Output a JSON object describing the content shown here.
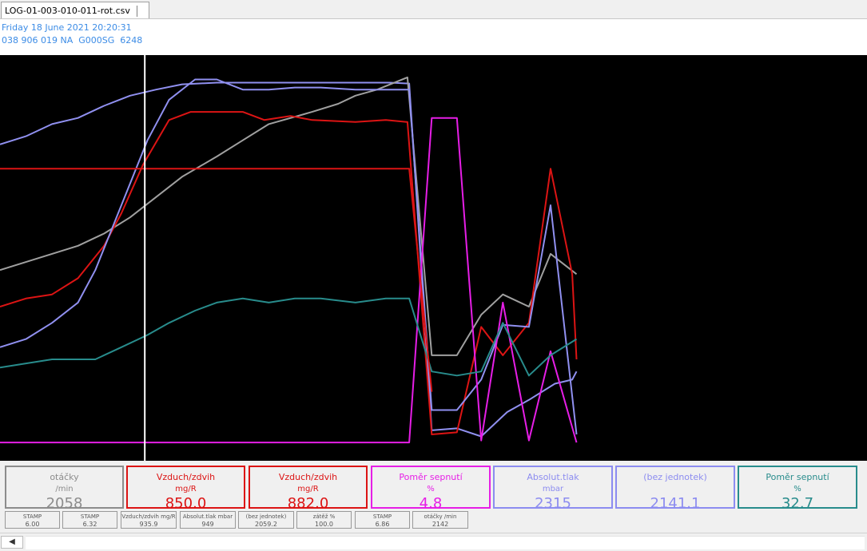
{
  "tab": {
    "filename": "LOG-01-003-010-011-rot.csv"
  },
  "info": {
    "date": "Friday 18 June 2021 20:20:31",
    "vehicle": "038 906 019 NA  G000SG  6248"
  },
  "gauges": [
    {
      "title": "otáčky",
      "unit": "/min",
      "value": "2058",
      "color": "#8c8c8c",
      "value_color": "#8c8c8c"
    },
    {
      "title": "Vzduch/zdvih",
      "unit": "mg/R",
      "value": "850.0",
      "color": "#dc1414",
      "value_color": "#dc1414"
    },
    {
      "title": "Vzduch/zdvih",
      "unit": "mg/R",
      "value": "882.0",
      "color": "#dc1414",
      "value_color": "#dc1414"
    },
    {
      "title": "Poměr sepnutí",
      "unit": "%",
      "value": "4.8",
      "color": "#e61ee6",
      "value_color": "#e61ee6"
    },
    {
      "title": "Absolut.tlak",
      "unit": "mbar",
      "value": "2315",
      "color": "#8c8cf0",
      "value_color": "#8c8cf0"
    },
    {
      "title": "(bez jednotek)",
      "unit": "",
      "value": "2141.1",
      "color": "#8c8cf0",
      "value_color": "#8c8cf0"
    },
    {
      "title": "Poměr sepnutí",
      "unit": "%",
      "value": "32.7",
      "color": "#288c8c",
      "value_color": "#288c8c"
    }
  ],
  "minis": [
    {
      "title": "STAMP",
      "value": "6.00"
    },
    {
      "title": "STAMP",
      "value": "6.32"
    },
    {
      "title": "Vzduch/zdvih mg/R",
      "value": "935.9"
    },
    {
      "title": "Absolut.tlak mbar",
      "value": "949"
    },
    {
      "title": "(bez jednotek)",
      "value": "2059.2"
    },
    {
      "title": "zátěž %",
      "value": "100.0"
    },
    {
      "title": "STAMP",
      "value": "6.86"
    },
    {
      "title": "otáčky /min",
      "value": "2142"
    }
  ],
  "chart_data": {
    "type": "line",
    "cursor_position": 0.167,
    "series": [
      {
        "color": "#9090f0",
        "points": [
          [
            0,
            0.22
          ],
          [
            0.03,
            0.2
          ],
          [
            0.06,
            0.17
          ],
          [
            0.09,
            0.155
          ],
          [
            0.12,
            0.125
          ],
          [
            0.15,
            0.1
          ],
          [
            0.18,
            0.085
          ],
          [
            0.21,
            0.072
          ],
          [
            0.25,
            0.068
          ],
          [
            0.29,
            0.068
          ],
          [
            0.33,
            0.068
          ],
          [
            0.37,
            0.068
          ],
          [
            0.41,
            0.068
          ],
          [
            0.45,
            0.068
          ],
          [
            0.472,
            0.07
          ],
          [
            0.498,
            0.925
          ],
          [
            0.527,
            0.92
          ],
          [
            0.555,
            0.94
          ],
          [
            0.585,
            0.88
          ],
          [
            0.61,
            0.85
          ],
          [
            0.64,
            0.81
          ],
          [
            0.66,
            0.8
          ],
          [
            0.665,
            0.78
          ]
        ]
      },
      {
        "color": "#a0a0a0",
        "points": [
          [
            0,
            0.53
          ],
          [
            0.03,
            0.51
          ],
          [
            0.06,
            0.49
          ],
          [
            0.09,
            0.47
          ],
          [
            0.12,
            0.44
          ],
          [
            0.15,
            0.4
          ],
          [
            0.18,
            0.35
          ],
          [
            0.21,
            0.3
          ],
          [
            0.25,
            0.25
          ],
          [
            0.28,
            0.21
          ],
          [
            0.31,
            0.17
          ],
          [
            0.36,
            0.14
          ],
          [
            0.39,
            0.12
          ],
          [
            0.41,
            0.1
          ],
          [
            0.435,
            0.085
          ],
          [
            0.47,
            0.055
          ],
          [
            0.498,
            0.74
          ],
          [
            0.527,
            0.74
          ],
          [
            0.555,
            0.64
          ],
          [
            0.58,
            0.59
          ],
          [
            0.61,
            0.62
          ],
          [
            0.635,
            0.49
          ],
          [
            0.665,
            0.54
          ]
        ]
      },
      {
        "color": "#dc1414",
        "points": [
          [
            0,
            0.62
          ],
          [
            0.03,
            0.6
          ],
          [
            0.06,
            0.59
          ],
          [
            0.09,
            0.55
          ],
          [
            0.12,
            0.47
          ],
          [
            0.14,
            0.39
          ],
          [
            0.165,
            0.27
          ],
          [
            0.195,
            0.16
          ],
          [
            0.22,
            0.14
          ],
          [
            0.25,
            0.14
          ],
          [
            0.28,
            0.14
          ],
          [
            0.305,
            0.16
          ],
          [
            0.335,
            0.15
          ],
          [
            0.36,
            0.16
          ],
          [
            0.41,
            0.165
          ],
          [
            0.445,
            0.16
          ],
          [
            0.47,
            0.165
          ],
          [
            0.498,
            0.935
          ],
          [
            0.527,
            0.93
          ],
          [
            0.555,
            0.67
          ],
          [
            0.58,
            0.74
          ],
          [
            0.61,
            0.66
          ],
          [
            0.635,
            0.28
          ],
          [
            0.66,
            0.54
          ],
          [
            0.665,
            0.75
          ]
        ]
      },
      {
        "color": "#9090f0",
        "points": [
          [
            0,
            0.72
          ],
          [
            0.03,
            0.7
          ],
          [
            0.06,
            0.66
          ],
          [
            0.09,
            0.61
          ],
          [
            0.11,
            0.53
          ],
          [
            0.14,
            0.37
          ],
          [
            0.17,
            0.21
          ],
          [
            0.195,
            0.11
          ],
          [
            0.225,
            0.06
          ],
          [
            0.25,
            0.06
          ],
          [
            0.28,
            0.085
          ],
          [
            0.31,
            0.085
          ],
          [
            0.34,
            0.08
          ],
          [
            0.37,
            0.08
          ],
          [
            0.41,
            0.085
          ],
          [
            0.445,
            0.085
          ],
          [
            0.472,
            0.085
          ],
          [
            0.498,
            0.875
          ],
          [
            0.527,
            0.875
          ],
          [
            0.555,
            0.8
          ],
          [
            0.58,
            0.665
          ],
          [
            0.61,
            0.67
          ],
          [
            0.635,
            0.37
          ],
          [
            0.665,
            0.935
          ]
        ]
      },
      {
        "color": "#e61ee6",
        "points": [
          [
            0,
            0.955
          ],
          [
            0.472,
            0.955
          ],
          [
            0.498,
            0.155
          ],
          [
            0.527,
            0.155
          ],
          [
            0.555,
            0.95
          ],
          [
            0.58,
            0.61
          ],
          [
            0.61,
            0.95
          ],
          [
            0.635,
            0.73
          ],
          [
            0.665,
            0.955
          ]
        ]
      },
      {
        "color": "#288c8c",
        "points": [
          [
            0,
            0.77
          ],
          [
            0.03,
            0.76
          ],
          [
            0.06,
            0.75
          ],
          [
            0.09,
            0.75
          ],
          [
            0.11,
            0.75
          ],
          [
            0.14,
            0.72
          ],
          [
            0.17,
            0.69
          ],
          [
            0.195,
            0.66
          ],
          [
            0.225,
            0.63
          ],
          [
            0.25,
            0.61
          ],
          [
            0.28,
            0.6
          ],
          [
            0.31,
            0.61
          ],
          [
            0.34,
            0.6
          ],
          [
            0.37,
            0.6
          ],
          [
            0.41,
            0.61
          ],
          [
            0.445,
            0.6
          ],
          [
            0.472,
            0.6
          ],
          [
            0.498,
            0.78
          ],
          [
            0.527,
            0.79
          ],
          [
            0.555,
            0.78
          ],
          [
            0.58,
            0.66
          ],
          [
            0.61,
            0.79
          ],
          [
            0.635,
            0.74
          ],
          [
            0.665,
            0.7
          ]
        ]
      },
      {
        "color": "#dc1414",
        "points": [
          [
            0,
            0.28
          ],
          [
            0.472,
            0.28
          ],
          [
            0.498,
            0.83
          ]
        ]
      }
    ]
  },
  "scrollbar": {
    "left_arrow": "◀"
  }
}
